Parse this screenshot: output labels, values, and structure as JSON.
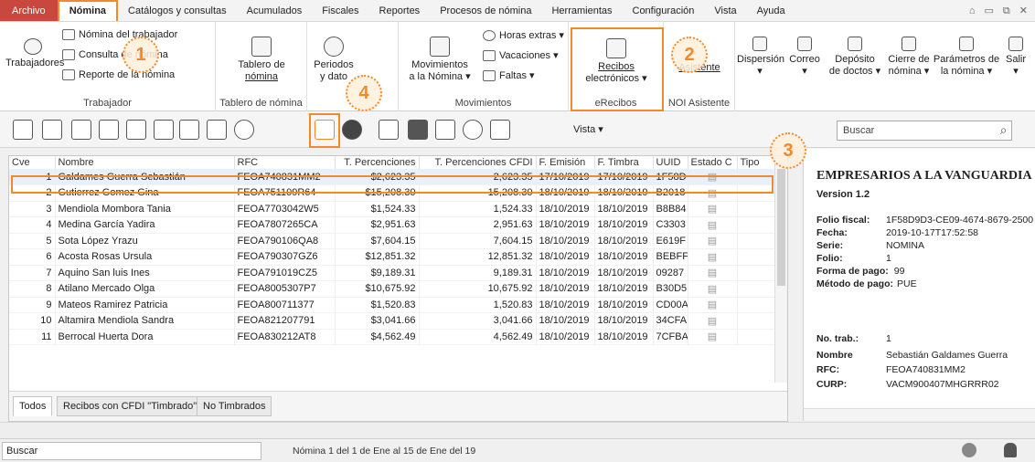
{
  "menu": {
    "items": [
      "Archivo",
      "Nómina",
      "Catálogos y consultas",
      "Acumulados",
      "Fiscales",
      "Reportes",
      "Procesos de nómina",
      "Herramientas",
      "Configuración",
      "Vista",
      "Ayuda"
    ],
    "window_controls": [
      "⌂",
      "▭",
      "⧉",
      "✕"
    ]
  },
  "ribbon": {
    "trabajador": {
      "big_label": "Trabajadores",
      "small1": "Nómina del trabajador",
      "small2": "Consulta de nómina",
      "small3": "Reporte de la nómina",
      "group": "Trabajador"
    },
    "tablero": {
      "label1": "Tablero de",
      "label2": "nómina",
      "group": "Tablero de nómina"
    },
    "periodos": {
      "label1": "Periodos",
      "label2": "y dato"
    },
    "movimientos": {
      "label1": "Movimientos",
      "label2": "a la Nómina ▾",
      "horas": "Horas extras ▾",
      "vacaciones": "Vacaciones ▾",
      "faltas": "Faltas ▾",
      "group": "Movimientos"
    },
    "erecibos": {
      "label1": "Recibos",
      "label2": "electrónicos ▾",
      "group": "eRecibos"
    },
    "noi": {
      "label": "Asistente",
      "group": "NOI Asistente"
    },
    "right_buttons": [
      {
        "l1": "Dispersión",
        "l2": "▾"
      },
      {
        "l1": "Correo",
        "l2": "▾"
      },
      {
        "l1": "Depósito",
        "l2": "de doctos ▾"
      },
      {
        "l1": "Cierre de",
        "l2": "nómina ▾"
      },
      {
        "l1": "Parámetros de",
        "l2": "la nómina ▾"
      },
      {
        "l1": "Salir",
        "l2": "▾"
      }
    ]
  },
  "callouts": [
    "1",
    "2",
    "3",
    "4"
  ],
  "toolbar": {
    "vista": "Vista ▾",
    "search_placeholder": "Buscar",
    "search_icon": "magnifier-icon"
  },
  "grid": {
    "columns": [
      "Cve",
      "Nombre",
      "RFC",
      "T. Percenciones",
      "T. Percenciones CFDI",
      "F. Emisión",
      "F. Timbra",
      "UUID",
      "Estado C",
      "Tipo"
    ],
    "rows": [
      [
        "1",
        "Galdames Guerra Sebastián",
        "FEOA740831MM2",
        "$2,623.35",
        "2,623.35",
        "17/10/2019",
        "17/10/2019",
        "1F58D"
      ],
      [
        "2",
        "Gutierrez Gomez Gina",
        "FEOA751109R64",
        "$15,208.30",
        "15,208.30",
        "18/10/2019",
        "18/10/2019",
        "B2018"
      ],
      [
        "3",
        "Mendiola Mombora Tania",
        "FEOA7703042W5",
        "$1,524.33",
        "1,524.33",
        "18/10/2019",
        "18/10/2019",
        "B8B84"
      ],
      [
        "4",
        "Medina García Yadira",
        "FEOA7807265CA",
        "$2,951.63",
        "2,951.63",
        "18/10/2019",
        "18/10/2019",
        "C3303"
      ],
      [
        "5",
        "Sota López Yrazu",
        "FEOA790106QA8",
        "$7,604.15",
        "7,604.15",
        "18/10/2019",
        "18/10/2019",
        "E619F"
      ],
      [
        "6",
        "Acosta Rosas Ursula",
        "FEOA790307GZ6",
        "$12,851.32",
        "12,851.32",
        "18/10/2019",
        "18/10/2019",
        "BEBFF"
      ],
      [
        "7",
        "Aquino San luis Ines",
        "FEOA791019CZ5",
        "$9,189.31",
        "9,189.31",
        "18/10/2019",
        "18/10/2019",
        "09287"
      ],
      [
        "8",
        "Atilano Mercado Olga",
        "FEOA8005307P7",
        "$10,675.92",
        "10,675.92",
        "18/10/2019",
        "18/10/2019",
        "B30D5"
      ],
      [
        "9",
        "Mateos Ramirez Patricia",
        "FEOA800711377",
        "$1,520.83",
        "1,520.83",
        "18/10/2019",
        "18/10/2019",
        "CD00A"
      ],
      [
        "10",
        "Altamira Mendiola Sandra",
        "FEOA821207791",
        "$3,041.66",
        "3,041.66",
        "18/10/2019",
        "18/10/2019",
        "34CFA"
      ],
      [
        "11",
        "Berrocal Huerta Dora",
        "FEOA830212AT8",
        "$4,562.49",
        "4,562.49",
        "18/10/2019",
        "18/10/2019",
        "7CFBA"
      ]
    ],
    "tabs": [
      "Todos",
      "Recibos con CFDI \"Timbrado\"",
      "No Timbrados"
    ]
  },
  "preview": {
    "company": "EMPRESARIOS A LA VANGUARDIA",
    "version": "Version 1.2",
    "fields": [
      {
        "k": "Folio fiscal:",
        "v": "1F58D9D3-CE09-4674-8679-2500"
      },
      {
        "k": "Fecha:",
        "v": "2019-10-17T17:52:58"
      },
      {
        "k": "Serie:",
        "v": "NOMINA"
      },
      {
        "k": "Folio:",
        "v": "1"
      },
      {
        "k": "Forma de pago:",
        "v": "99"
      },
      {
        "k": "Método de pago:",
        "v": "PUE"
      }
    ],
    "worker": [
      {
        "k": "No. trab.:",
        "v": "1"
      },
      {
        "k": "Nombre",
        "v": "Sebastián Galdames Guerra"
      },
      {
        "k": "RFC:",
        "v": "FEOA740831MM2"
      },
      {
        "k": "CURP:",
        "v": "VACM900407MHGRRR02"
      }
    ]
  },
  "status": {
    "search": "Buscar",
    "text": "Nómina  1 del 1 de Ene al 15 de Ene del 19"
  }
}
